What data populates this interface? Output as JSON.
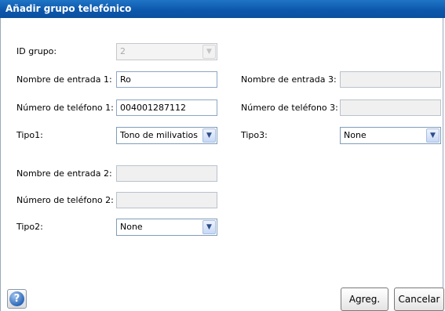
{
  "dialog": {
    "title": "Añadir grupo telefónico"
  },
  "group_id": {
    "label": "ID grupo:",
    "value": "2"
  },
  "entry1": {
    "name_label": "Nombre de entrada 1:",
    "name_value": "Ro",
    "phone_label": "Número de teléfono 1:",
    "phone_value": "004001287112",
    "type_label": "Tipo1:",
    "type_value": "Tono de milivatios"
  },
  "entry2": {
    "name_label": "Nombre de entrada 2:",
    "name_value": "",
    "phone_label": "Número de teléfono 2:",
    "phone_value": "",
    "type_label": "Tipo2:",
    "type_value": "None"
  },
  "entry3": {
    "name_label": "Nombre de entrada 3:",
    "name_value": "",
    "phone_label": "Número de teléfono 3:",
    "phone_value": "",
    "type_label": "Tipo3:",
    "type_value": "None"
  },
  "footer": {
    "help_glyph": "?",
    "add_label": "Agreg.",
    "cancel_label": "Cancelar"
  },
  "icons": {
    "help": "help-icon",
    "dropdown": "chevron-down-icon"
  },
  "colors": {
    "titlebar": "#0d58ad",
    "field_border": "#8ea6c4"
  }
}
